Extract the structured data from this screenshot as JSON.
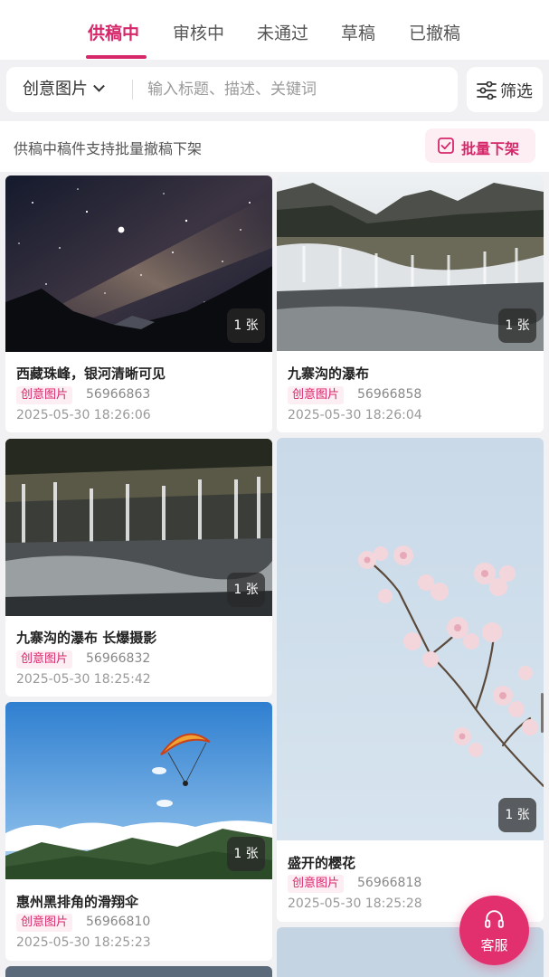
{
  "tabs": [
    {
      "label": "供稿中",
      "active": true
    },
    {
      "label": "审核中",
      "active": false
    },
    {
      "label": "未通过",
      "active": false
    },
    {
      "label": "草稿",
      "active": false
    },
    {
      "label": "已撤稿",
      "active": false
    }
  ],
  "search": {
    "category": "创意图片",
    "placeholder": "输入标题、描述、关键词",
    "value": ""
  },
  "filter": {
    "label": "筛选",
    "icon": "sliders-icon"
  },
  "notice": {
    "text": "供稿中稿件支持批量撤稿下架",
    "batch_label": "批量下架",
    "batch_icon": "checkbox-icon"
  },
  "cards": [
    {
      "title": "西藏珠峰，银河清晰可见",
      "tag": "创意图片",
      "id": "56966863",
      "date": "2025-05-30 18:26:06",
      "count": "1 张",
      "image": "milky-way-night-sky"
    },
    {
      "title": "九寨沟的瀑布",
      "tag": "创意图片",
      "id": "56966858",
      "date": "2025-05-30 18:26:04",
      "count": "1 张",
      "image": "waterfall"
    },
    {
      "title": "九寨沟的瀑布 长爆摄影",
      "tag": "创意图片",
      "id": "56966832",
      "date": "2025-05-30 18:25:42",
      "count": "1 张",
      "image": "waterfall-long-exposure"
    },
    {
      "title": "盛开的樱花",
      "tag": "创意图片",
      "id": "56966818",
      "date": "2025-05-30 18:25:28",
      "count": "1 张",
      "image": "cherry-blossom"
    },
    {
      "title": "惠州黑排角的滑翔伞",
      "tag": "创意图片",
      "id": "56966810",
      "date": "2025-05-30 18:25:23",
      "count": "1 张",
      "image": "paraglider"
    }
  ],
  "customer_service": {
    "label": "客服",
    "icon": "headset-icon"
  },
  "colors": {
    "accent": "#d6276a",
    "fab": "#e2306f",
    "tag_bg": "#fdeef3"
  }
}
